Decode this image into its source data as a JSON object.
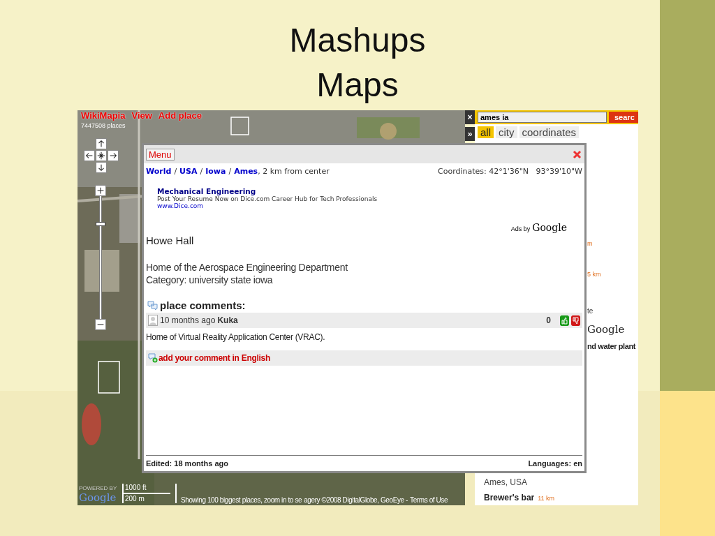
{
  "slide": {
    "title": "Mashups",
    "subtitle": "Maps"
  },
  "map": {
    "menu_links": [
      "WikiMapia",
      "View",
      "Add place"
    ],
    "places_count": "7447508 places",
    "zoom_slider": {
      "level": 0.78
    },
    "powered_by": "POWERED BY",
    "logo": "Google",
    "scale": [
      "1000 ft",
      "200 m"
    ],
    "status": "Showing 100 biggest places, zoom in to se",
    "imagery": "agery ©2008 DigitalGlobe, GeoEye -",
    "terms_link": "Terms of Use"
  },
  "search": {
    "close": "×",
    "query": "ames ia",
    "button": "searc",
    "expand": "»",
    "tabs": [
      {
        "label": "all",
        "selected": true
      },
      {
        "label": "city",
        "selected": false
      },
      {
        "label": "coordinates",
        "selected": false
      }
    ],
    "results": [
      {
        "kind": "distance",
        "text": "m"
      },
      {
        "kind": "distance",
        "text": "5 km"
      },
      {
        "kind": "small",
        "text": "te"
      },
      {
        "kind": "logo",
        "text": "Google"
      },
      {
        "kind": "title",
        "text": "nd water plant"
      }
    ],
    "bottom_results": [
      {
        "kind": "place",
        "text": "Ames, USA"
      },
      {
        "kind": "title",
        "text": "Brewer's bar",
        "distance": "11 km"
      }
    ]
  },
  "popup": {
    "menu": "Menu",
    "breadcrumb": [
      {
        "kind": "link",
        "text": "World"
      },
      {
        "kind": "sep",
        "text": "/"
      },
      {
        "kind": "link",
        "text": "USA"
      },
      {
        "kind": "sep",
        "text": "/"
      },
      {
        "kind": "link",
        "text": "Iowa"
      },
      {
        "kind": "sep",
        "text": "/"
      },
      {
        "kind": "link",
        "text": "Ames"
      },
      {
        "kind": "plain",
        "text": ", 2 km from center"
      }
    ],
    "coordinates": "Coordinates: 42°1'36\"N   93°39'10\"W",
    "ad": {
      "title": "Mechanical Engineering",
      "text": "Post Your Resume Now on Dice.com Career Hub for Tech Professionals",
      "url": "www.Dice.com",
      "ads_by": "Ads by",
      "ads_brand": "Google"
    },
    "place": {
      "name": "Howe Hall",
      "description": "Home of the Aerospace Engineering Department",
      "category": "Category: university state iowa"
    },
    "comments_heading": "place comments:",
    "comments": [
      {
        "time": "10 months ago",
        "author": "Kuka",
        "score": "0",
        "text": "Home of Virtual Reality Application Center (VRAC)."
      }
    ],
    "add_comment": "add your comment in English",
    "edited": "Edited: 18 months ago",
    "languages": "Languages: en"
  }
}
